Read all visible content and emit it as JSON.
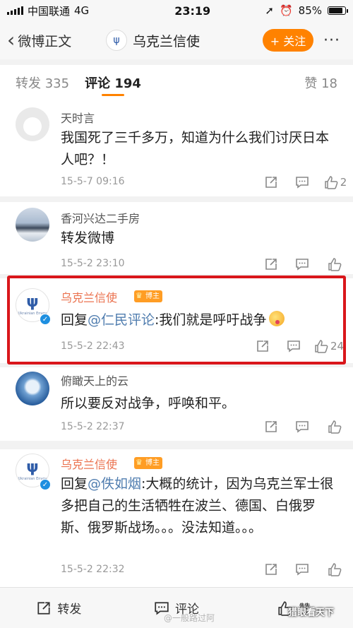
{
  "status_bar": {
    "carrier": "中国联通",
    "network": "4G",
    "time": "23:19",
    "battery": "85%"
  },
  "nav": {
    "back_label": "微博正文",
    "title": "乌克兰信使",
    "follow_label": "+ 关注",
    "more_label": "···"
  },
  "tabs": {
    "repost": "转发 335",
    "comments": "评论 194",
    "likes": "赞 18"
  },
  "comments": [
    {
      "name": "天时言",
      "text": "我国死了三千多万，知道为什么我们讨厌日本人吧？！",
      "time": "15-5-7 09:16",
      "like_count": "2"
    },
    {
      "name": "香河兴达二手房",
      "text": "转发微博",
      "time": "15-5-2 23:10",
      "like_count": ""
    },
    {
      "name": "乌克兰信使",
      "badge": "博主",
      "reply_prefix": "回复",
      "mention": "@仁民评论",
      "text": ":我们就是呼吁战争",
      "time": "15-5-2 22:43",
      "like_count": "24"
    },
    {
      "name": "俯瞰天上的云",
      "text": "所以要反对战争，呼唤和平。",
      "time": "15-5-2 22:37",
      "like_count": ""
    },
    {
      "name": "乌克兰信使",
      "badge": "博主",
      "reply_prefix": "回复",
      "mention": "@佚如烟",
      "text": ":大概的统计，因为乌克兰军士很多把自己的生活牺牲在波兰、德国、白俄罗斯、俄罗斯战场。。。没法知道。。。",
      "time": "15-5-2 22:32",
      "like_count": ""
    }
  ],
  "avatar_text": {
    "trident": "ψ",
    "sub": "Ukrainian Envoy"
  },
  "bottom_bar": {
    "repost": "转发",
    "comment": "评论",
    "like": "赞"
  },
  "watermarks": {
    "center": "@一般路过阿",
    "right": "猎眼看天下"
  },
  "colors": {
    "accent": "#ff8200",
    "name_highlight": "#eb7350",
    "mention": "#507daf",
    "annotation_box": "#d9161b"
  }
}
